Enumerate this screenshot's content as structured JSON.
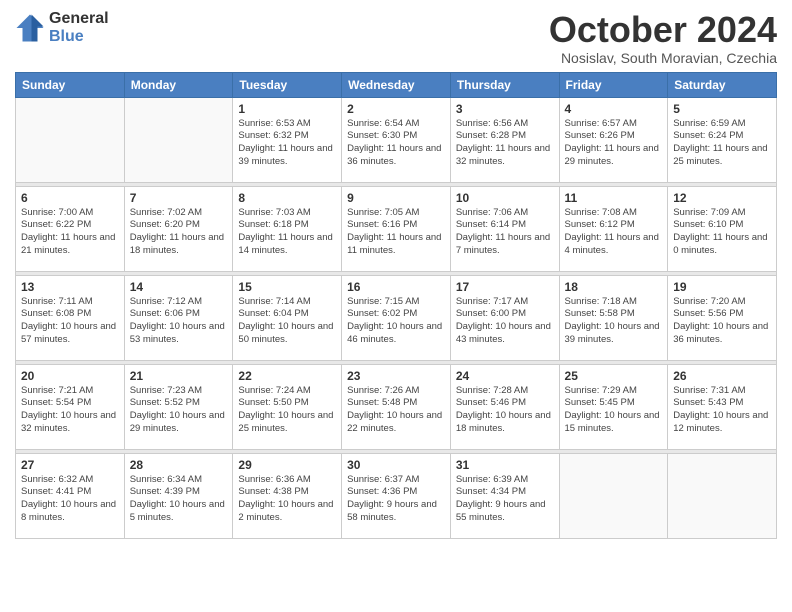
{
  "logo": {
    "general": "General",
    "blue": "Blue"
  },
  "header": {
    "month": "October 2024",
    "location": "Nosislav, South Moravian, Czechia"
  },
  "weekdays": [
    "Sunday",
    "Monday",
    "Tuesday",
    "Wednesday",
    "Thursday",
    "Friday",
    "Saturday"
  ],
  "weeks": [
    [
      {
        "day": "",
        "info": ""
      },
      {
        "day": "",
        "info": ""
      },
      {
        "day": "1",
        "info": "Sunrise: 6:53 AM\nSunset: 6:32 PM\nDaylight: 11 hours and 39 minutes."
      },
      {
        "day": "2",
        "info": "Sunrise: 6:54 AM\nSunset: 6:30 PM\nDaylight: 11 hours and 36 minutes."
      },
      {
        "day": "3",
        "info": "Sunrise: 6:56 AM\nSunset: 6:28 PM\nDaylight: 11 hours and 32 minutes."
      },
      {
        "day": "4",
        "info": "Sunrise: 6:57 AM\nSunset: 6:26 PM\nDaylight: 11 hours and 29 minutes."
      },
      {
        "day": "5",
        "info": "Sunrise: 6:59 AM\nSunset: 6:24 PM\nDaylight: 11 hours and 25 minutes."
      }
    ],
    [
      {
        "day": "6",
        "info": "Sunrise: 7:00 AM\nSunset: 6:22 PM\nDaylight: 11 hours and 21 minutes."
      },
      {
        "day": "7",
        "info": "Sunrise: 7:02 AM\nSunset: 6:20 PM\nDaylight: 11 hours and 18 minutes."
      },
      {
        "day": "8",
        "info": "Sunrise: 7:03 AM\nSunset: 6:18 PM\nDaylight: 11 hours and 14 minutes."
      },
      {
        "day": "9",
        "info": "Sunrise: 7:05 AM\nSunset: 6:16 PM\nDaylight: 11 hours and 11 minutes."
      },
      {
        "day": "10",
        "info": "Sunrise: 7:06 AM\nSunset: 6:14 PM\nDaylight: 11 hours and 7 minutes."
      },
      {
        "day": "11",
        "info": "Sunrise: 7:08 AM\nSunset: 6:12 PM\nDaylight: 11 hours and 4 minutes."
      },
      {
        "day": "12",
        "info": "Sunrise: 7:09 AM\nSunset: 6:10 PM\nDaylight: 11 hours and 0 minutes."
      }
    ],
    [
      {
        "day": "13",
        "info": "Sunrise: 7:11 AM\nSunset: 6:08 PM\nDaylight: 10 hours and 57 minutes."
      },
      {
        "day": "14",
        "info": "Sunrise: 7:12 AM\nSunset: 6:06 PM\nDaylight: 10 hours and 53 minutes."
      },
      {
        "day": "15",
        "info": "Sunrise: 7:14 AM\nSunset: 6:04 PM\nDaylight: 10 hours and 50 minutes."
      },
      {
        "day": "16",
        "info": "Sunrise: 7:15 AM\nSunset: 6:02 PM\nDaylight: 10 hours and 46 minutes."
      },
      {
        "day": "17",
        "info": "Sunrise: 7:17 AM\nSunset: 6:00 PM\nDaylight: 10 hours and 43 minutes."
      },
      {
        "day": "18",
        "info": "Sunrise: 7:18 AM\nSunset: 5:58 PM\nDaylight: 10 hours and 39 minutes."
      },
      {
        "day": "19",
        "info": "Sunrise: 7:20 AM\nSunset: 5:56 PM\nDaylight: 10 hours and 36 minutes."
      }
    ],
    [
      {
        "day": "20",
        "info": "Sunrise: 7:21 AM\nSunset: 5:54 PM\nDaylight: 10 hours and 32 minutes."
      },
      {
        "day": "21",
        "info": "Sunrise: 7:23 AM\nSunset: 5:52 PM\nDaylight: 10 hours and 29 minutes."
      },
      {
        "day": "22",
        "info": "Sunrise: 7:24 AM\nSunset: 5:50 PM\nDaylight: 10 hours and 25 minutes."
      },
      {
        "day": "23",
        "info": "Sunrise: 7:26 AM\nSunset: 5:48 PM\nDaylight: 10 hours and 22 minutes."
      },
      {
        "day": "24",
        "info": "Sunrise: 7:28 AM\nSunset: 5:46 PM\nDaylight: 10 hours and 18 minutes."
      },
      {
        "day": "25",
        "info": "Sunrise: 7:29 AM\nSunset: 5:45 PM\nDaylight: 10 hours and 15 minutes."
      },
      {
        "day": "26",
        "info": "Sunrise: 7:31 AM\nSunset: 5:43 PM\nDaylight: 10 hours and 12 minutes."
      }
    ],
    [
      {
        "day": "27",
        "info": "Sunrise: 6:32 AM\nSunset: 4:41 PM\nDaylight: 10 hours and 8 minutes."
      },
      {
        "day": "28",
        "info": "Sunrise: 6:34 AM\nSunset: 4:39 PM\nDaylight: 10 hours and 5 minutes."
      },
      {
        "day": "29",
        "info": "Sunrise: 6:36 AM\nSunset: 4:38 PM\nDaylight: 10 hours and 2 minutes."
      },
      {
        "day": "30",
        "info": "Sunrise: 6:37 AM\nSunset: 4:36 PM\nDaylight: 9 hours and 58 minutes."
      },
      {
        "day": "31",
        "info": "Sunrise: 6:39 AM\nSunset: 4:34 PM\nDaylight: 9 hours and 55 minutes."
      },
      {
        "day": "",
        "info": ""
      },
      {
        "day": "",
        "info": ""
      }
    ]
  ]
}
